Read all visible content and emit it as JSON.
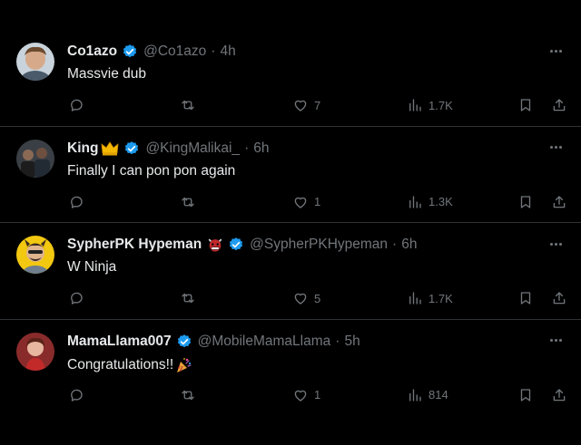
{
  "tweets": [
    {
      "name": "Co1azo",
      "handle": "@Co1azo",
      "dot": "·",
      "time": "4h",
      "text": "Massvie dub",
      "likes": "7",
      "views": "1.7K",
      "avatar_color": "#c9d3dc",
      "name_emoji": "",
      "text_emoji": ""
    },
    {
      "name": "King",
      "handle": "@KingMalikai_",
      "dot": "·",
      "time": "6h",
      "text": "Finally I can pon pon again",
      "likes": "1",
      "views": "1.3K",
      "avatar_color": "#3a3f45",
      "name_emoji": "crown-icon",
      "text_emoji": ""
    },
    {
      "name": "SypherPK Hypeman",
      "handle": "@SypherPKHypeman",
      "dot": "·",
      "time": "6h",
      "text": "W Ninja",
      "likes": "5",
      "views": "1.7K",
      "avatar_color": "#f2c811",
      "name_emoji": "ogre-icon",
      "text_emoji": ""
    },
    {
      "name": "MamaLlama007",
      "handle": "@MobileMamaLlama",
      "dot": "·",
      "time": "5h",
      "text": "Congratulations!!",
      "likes": "1",
      "views": "814",
      "avatar_color": "#8a2b2b",
      "name_emoji": "",
      "text_emoji": "party-popper-icon"
    }
  ],
  "colors": {
    "background": "#000000",
    "text": "#e7e9ea",
    "muted": "#71767b",
    "verified": "#1d9bf0",
    "divider": "#2f3336"
  }
}
